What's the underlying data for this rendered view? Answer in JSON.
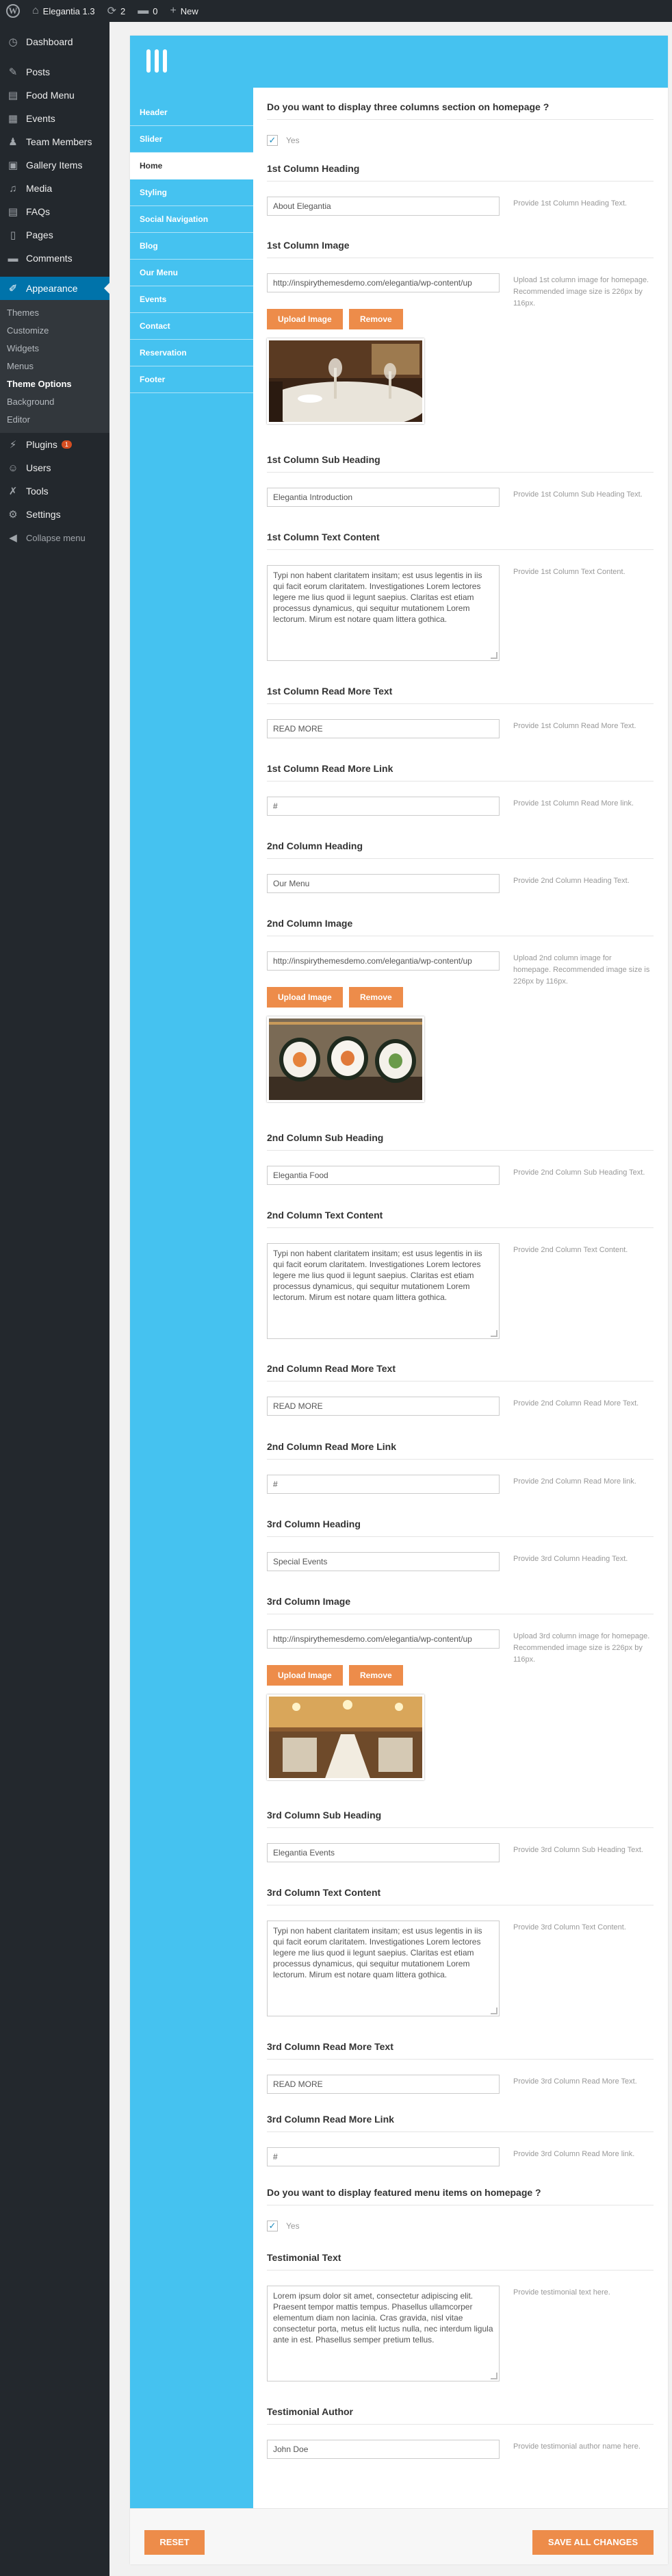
{
  "adminbar": {
    "site_name": "Elegantia 1.3",
    "updates_count": "2",
    "comments_count": "0",
    "new_label": "New"
  },
  "sidebar": {
    "items": [
      {
        "label": "Dashboard",
        "icon": "dashboard-icon"
      },
      {
        "label": "Posts",
        "icon": "pin-icon"
      },
      {
        "label": "Food Menu",
        "icon": "document-icon"
      },
      {
        "label": "Events",
        "icon": "calendar-icon"
      },
      {
        "label": "Team Members",
        "icon": "people-icon"
      },
      {
        "label": "Gallery Items",
        "icon": "gallery-icon"
      },
      {
        "label": "Media",
        "icon": "media-icon"
      },
      {
        "label": "FAQs",
        "icon": "faq-icon"
      },
      {
        "label": "Pages",
        "icon": "page-icon"
      },
      {
        "label": "Comments",
        "icon": "comment-icon"
      },
      {
        "label": "Appearance",
        "icon": "brush-icon"
      },
      {
        "label": "Plugins",
        "icon": "plugin-icon",
        "badge": "1"
      },
      {
        "label": "Users",
        "icon": "user-icon"
      },
      {
        "label": "Tools",
        "icon": "wrench-icon"
      },
      {
        "label": "Settings",
        "icon": "settings-icon"
      },
      {
        "label": "Collapse menu",
        "icon": "collapse-icon"
      }
    ],
    "appearance_sub": [
      "Themes",
      "Customize",
      "Widgets",
      "Menus",
      "Theme Options",
      "Background",
      "Editor"
    ]
  },
  "tabs": [
    "Header",
    "Slider",
    "Home",
    "Styling",
    "Social Navigation",
    "Blog",
    "Our Menu",
    "Events",
    "Contact",
    "Reservation",
    "Footer"
  ],
  "fields": {
    "three_cols": {
      "title": "Do you want to display three columns section on homepage ?",
      "check_label": "Yes"
    },
    "col1_heading": {
      "title": "1st Column Heading",
      "value": "About Elegantia",
      "help": "Provide 1st Column Heading Text."
    },
    "col1_image": {
      "title": "1st Column Image",
      "value": "http://inspirythemesdemo.com/elegantia/wp-content/up",
      "help": "Upload 1st column image for homepage. Recommended image size is 226px by 116px.",
      "upload": "Upload Image",
      "remove": "Remove"
    },
    "col1_sub": {
      "title": "1st Column Sub Heading",
      "value": "Elegantia Introduction",
      "help": "Provide 1st Column Sub Heading Text."
    },
    "col1_text": {
      "title": "1st Column Text Content",
      "value": "Typi non habent claritatem insitam; est usus legentis in iis qui facit eorum claritatem. Investigationes Lorem lectores legere me lius quod ii legunt saepius. Claritas est etiam processus dynamicus, qui sequitur mutationem Lorem lectorum. Mirum est notare quam littera gothica.",
      "help": "Provide 1st Column Text Content."
    },
    "col1_more_text": {
      "title": "1st Column Read More Text",
      "value": "READ MORE",
      "help": "Provide 1st Column Read More Text."
    },
    "col1_more_link": {
      "title": "1st Column Read More Link",
      "value": "#",
      "help": "Provide 1st Column Read More link."
    },
    "col2_heading": {
      "title": "2nd Column Heading",
      "value": "Our Menu",
      "help": "Provide 2nd Column Heading Text."
    },
    "col2_image": {
      "title": "2nd Column Image",
      "value": "http://inspirythemesdemo.com/elegantia/wp-content/up",
      "help": "Upload 2nd column image for homepage. Recommended image size is 226px by 116px.",
      "upload": "Upload Image",
      "remove": "Remove"
    },
    "col2_sub": {
      "title": "2nd Column Sub Heading",
      "value": "Elegantia Food",
      "help": "Provide 2nd Column Sub Heading Text."
    },
    "col2_text": {
      "title": "2nd Column Text Content",
      "value": "Typi non habent claritatem insitam; est usus legentis in iis qui facit eorum claritatem. Investigationes Lorem lectores legere me lius quod ii legunt saepius. Claritas est etiam processus dynamicus, qui sequitur mutationem Lorem lectorum. Mirum est notare quam littera gothica.",
      "help": "Provide 2nd Column Text Content."
    },
    "col2_more_text": {
      "title": "2nd Column Read More Text",
      "value": "READ MORE",
      "help": "Provide 2nd Column Read More Text."
    },
    "col2_more_link": {
      "title": "2nd Column Read More Link",
      "value": "#",
      "help": "Provide 2nd Column Read More link."
    },
    "col3_heading": {
      "title": "3rd Column Heading",
      "value": "Special Events",
      "help": "Provide 3rd Column Heading Text."
    },
    "col3_image": {
      "title": "3rd Column Image",
      "value": "http://inspirythemesdemo.com/elegantia/wp-content/up",
      "help": "Upload 3rd column image for homepage. Recommended image size is 226px by 116px.",
      "upload": "Upload Image",
      "remove": "Remove"
    },
    "col3_sub": {
      "title": "3rd Column Sub Heading",
      "value": "Elegantia Events",
      "help": "Provide 3rd Column Sub Heading Text."
    },
    "col3_text": {
      "title": "3rd Column Text Content",
      "value": "Typi non habent claritatem insitam; est usus legentis in iis qui facit eorum claritatem. Investigationes Lorem lectores legere me lius quod ii legunt saepius. Claritas est etiam processus dynamicus, qui sequitur mutationem Lorem lectorum. Mirum est notare quam littera gothica.",
      "help": "Provide 3rd Column Text Content."
    },
    "col3_more_text": {
      "title": "3rd Column Read More Text",
      "value": "READ MORE",
      "help": "Provide 3rd Column Read More Text."
    },
    "col3_more_link": {
      "title": "3rd Column Read More Link",
      "value": "#",
      "help": "Provide 3rd Column Read More link."
    },
    "featured_menu": {
      "title": "Do you want to display featured menu items on homepage ?",
      "check_label": "Yes"
    },
    "testimonial_text": {
      "title": "Testimonial Text",
      "value": "Lorem ipsum dolor sit amet, consectetur adipiscing elit. Praesent tempor mattis tempus. Phasellus ullamcorper elementum diam non lacinia. Cras gravida, nisl vitae consectetur porta, metus elit luctus nulla, nec interdum ligula ante in est. Phasellus semper pretium tellus.",
      "help": "Provide testimonial text here."
    },
    "testimonial_author": {
      "title": "Testimonial Author",
      "value": "John Doe",
      "help": "Provide testimonial author name here."
    }
  },
  "footer": {
    "reset": "RESET",
    "save": "SAVE ALL CHANGES"
  },
  "colors": {
    "accent": "#45c2f0",
    "button": "#ed8c4a",
    "wp_blue": "#0073aa",
    "sidebar": "#23282d"
  }
}
